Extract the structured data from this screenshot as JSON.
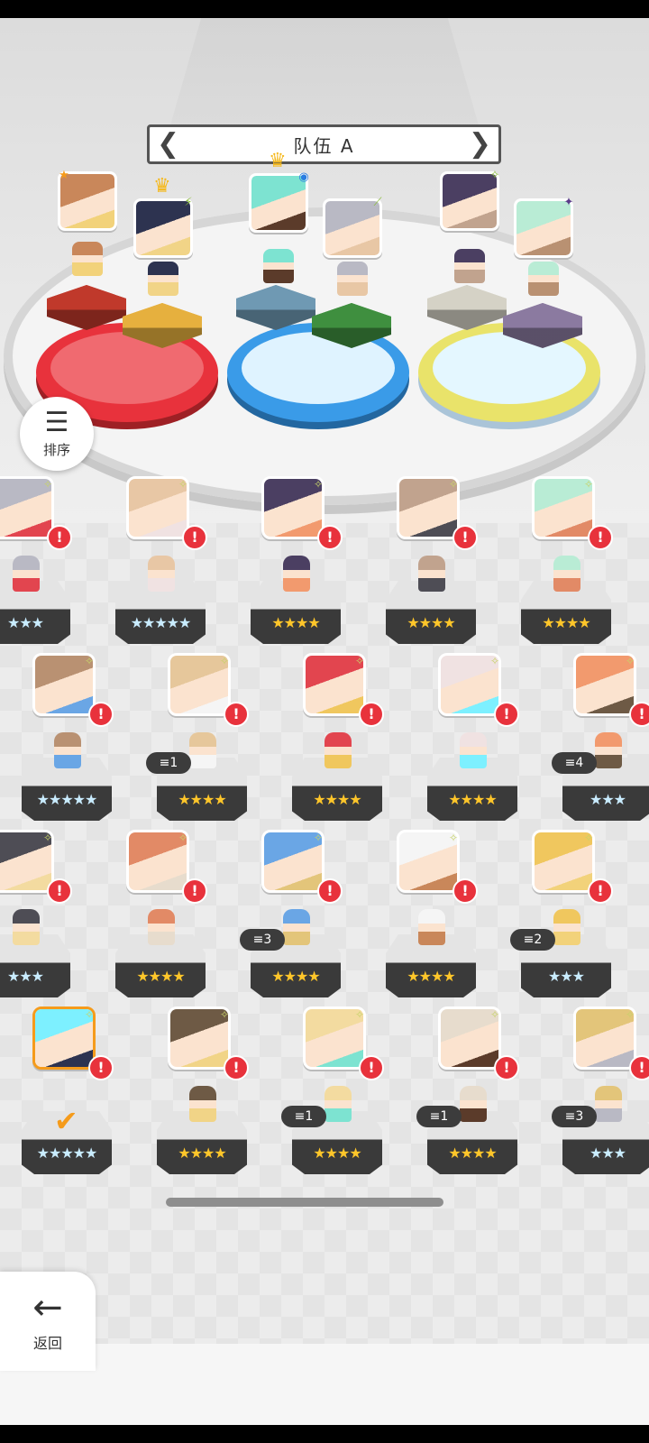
{
  "team": {
    "title": "队伍 A",
    "prev_arrow": "❮",
    "next_arrow": "❯"
  },
  "sort_button": {
    "icon": "sort-icon",
    "glyph": "☰",
    "label": "排序"
  },
  "back_button": {
    "icon": "back-arrow-icon",
    "glyph": "←",
    "label": "返回"
  },
  "colors": {
    "red_base": "#e8323c",
    "blue_base": "#3a9be8",
    "yellow_base": "#e9e36a",
    "alert": "#e8323c",
    "selected": "#f59b1b",
    "star_gold": "#ffc62a",
    "star_blue": "#c9ecff"
  },
  "team_slots": [
    {
      "badge_icon": "star-icon",
      "badge": "★",
      "element": "red",
      "pedestal": "#c0392b"
    },
    {
      "badge_icon": "lightning-icon",
      "badge": "⚡",
      "element": "red",
      "pedestal": "#e6b03e",
      "crown": "♛"
    },
    {
      "badge_icon": "circle-icon",
      "badge": "◉",
      "element": "blue",
      "pedestal": "#6f99b3",
      "crown": "♛"
    },
    {
      "badge_icon": "leaf-icon",
      "badge": "⟋",
      "element": "blue",
      "pedestal": "#3f8f3f"
    },
    {
      "badge_icon": "sparkle-icon",
      "badge": "✧",
      "element": "yellow",
      "pedestal": "#d5d2c6"
    },
    {
      "badge_icon": "shuriken-icon",
      "badge": "✦",
      "element": "yellow",
      "pedestal": "#8b7aa0"
    }
  ],
  "roster": [
    {
      "stars": "★★★",
      "star_color": "blue",
      "alert": "!",
      "dup": ""
    },
    {
      "stars": "★★★★★",
      "star_color": "blue",
      "alert": "!",
      "dup": ""
    },
    {
      "stars": "★★★★",
      "star_color": "gold",
      "alert": "!",
      "dup": ""
    },
    {
      "stars": "★★★★",
      "star_color": "gold",
      "alert": "!",
      "dup": ""
    },
    {
      "stars": "★★★★",
      "star_color": "gold",
      "alert": "!",
      "dup": ""
    },
    {
      "stars": "★★★★★",
      "star_color": "blue",
      "alert": "!",
      "dup": ""
    },
    {
      "stars": "★★★★",
      "star_color": "gold",
      "alert": "!",
      "dup": "1"
    },
    {
      "stars": "★★★★",
      "star_color": "gold",
      "alert": "!",
      "dup": ""
    },
    {
      "stars": "★★★★",
      "star_color": "gold",
      "alert": "!",
      "dup": ""
    },
    {
      "stars": "★★★",
      "star_color": "blue",
      "alert": "!",
      "dup": "4"
    },
    {
      "stars": "★★★",
      "star_color": "blue",
      "alert": "!",
      "dup": ""
    },
    {
      "stars": "★★★★",
      "star_color": "gold",
      "alert": "!",
      "dup": ""
    },
    {
      "stars": "★★★★",
      "star_color": "gold",
      "alert": "!",
      "dup": "3"
    },
    {
      "stars": "★★★★",
      "star_color": "gold",
      "alert": "!",
      "dup": ""
    },
    {
      "stars": "★★★",
      "star_color": "blue",
      "alert": "!",
      "dup": "2"
    },
    {
      "stars": "★★★★★",
      "star_color": "blue",
      "alert": "!",
      "dup": "",
      "selected": true,
      "check": "✔"
    },
    {
      "stars": "★★★★",
      "star_color": "gold",
      "alert": "!",
      "dup": ""
    },
    {
      "stars": "★★★★",
      "star_color": "gold",
      "alert": "!",
      "dup": "1"
    },
    {
      "stars": "★★★★",
      "star_color": "gold",
      "alert": "!",
      "dup": "1"
    },
    {
      "stars": "★★★",
      "star_color": "blue",
      "alert": "!",
      "dup": "3"
    }
  ]
}
